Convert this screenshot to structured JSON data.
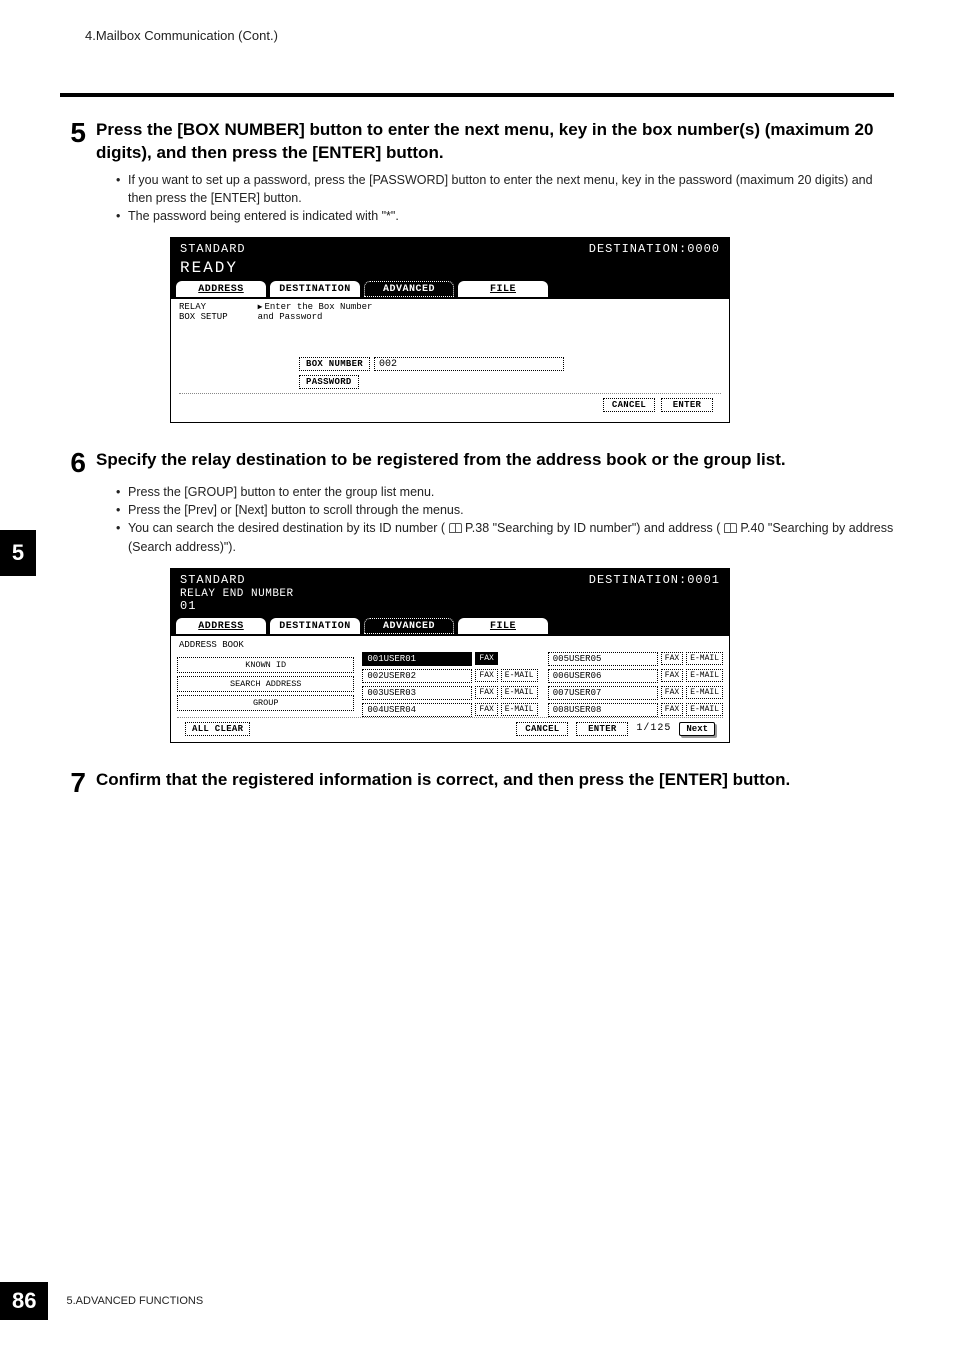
{
  "header": {
    "breadcrumb": "4.Mailbox Communication (Cont.)"
  },
  "side_chapter": "5",
  "step5": {
    "num": "5",
    "title": "Press the [BOX NUMBER] button to enter the next menu, key in the box number(s) (maximum 20 digits), and then press the [ENTER] button.",
    "bullets": [
      "If you want to set up a password, press the [PASSWORD] button to enter the next menu, key in the password (maximum 20 digits) and then press the [ENTER] button.",
      "The password being entered is indicated with \"*\"."
    ],
    "lcd": {
      "status": "STANDARD",
      "dest": "DESTINATION:0000",
      "ready": "READY",
      "tabs": {
        "address": "ADDRESS",
        "destination": "DESTINATION",
        "advanced": "ADVANCED",
        "file": "FILE"
      },
      "prompt_left_1": "RELAY",
      "prompt_left_2": "BOX SETUP",
      "prompt_right_1": "Enter the Box Number",
      "prompt_right_2": "and Password",
      "box_number_label": "BOX NUMBER",
      "box_number_value": "002",
      "password_label": "PASSWORD",
      "cancel": "CANCEL",
      "enter": "ENTER"
    }
  },
  "step6": {
    "num": "6",
    "title": "Specify the relay destination to be registered from the address book or the group list.",
    "bullets_plain": [
      "Press the [GROUP] button to enter the group list menu.",
      "Press the [Prev] or [Next] button to scroll through the menus."
    ],
    "bullet_search_prefix": "You can search the desired destination by its ID number (",
    "bullet_search_mid1": " P.38 \"Searching by ID number\") and address (",
    "bullet_search_mid2": " P.40 \"Searching by address (Search address)\").",
    "lcd": {
      "status": "STANDARD",
      "dest": "DESTINATION:0001",
      "line2": "RELAY END NUMBER",
      "line3": "01",
      "tabs": {
        "address": "ADDRESS",
        "destination": "DESTINATION",
        "advanced": "ADVANCED",
        "file": "FILE"
      },
      "ab_label": "ADDRESS BOOK",
      "rows": [
        {
          "left": {
            "id": "001",
            "name": "USER01",
            "fax_sel": true,
            "email": false
          },
          "right": {
            "id": "005",
            "name": "USER05",
            "fax_sel": false,
            "email": true
          }
        },
        {
          "left": {
            "id": "002",
            "name": "USER02",
            "fax_sel": false,
            "email": true
          },
          "right": {
            "id": "006",
            "name": "USER06",
            "fax_sel": false,
            "email": true
          }
        },
        {
          "left": {
            "id": "003",
            "name": "USER03",
            "fax_sel": false,
            "email": true
          },
          "right": {
            "id": "007",
            "name": "USER07",
            "fax_sel": false,
            "email": true
          }
        },
        {
          "left": {
            "id": "004",
            "name": "USER04",
            "fax_sel": false,
            "email": true
          },
          "right": {
            "id": "008",
            "name": "USER08",
            "fax_sel": false,
            "email": true
          }
        }
      ],
      "fax": "FAX",
      "email": "E-MAIL",
      "side": {
        "known_id": "KNOWN ID",
        "search_address": "SEARCH ADDRESS",
        "group": "GROUP"
      },
      "all_clear": "ALL CLEAR",
      "cancel": "CANCEL",
      "enter": "ENTER",
      "page": "1/125",
      "next": "Next"
    }
  },
  "step7": {
    "num": "7",
    "title": "Confirm that the registered information is correct, and then press the [ENTER] button."
  },
  "footer": {
    "page_number": "86",
    "section": "5.ADVANCED FUNCTIONS"
  }
}
